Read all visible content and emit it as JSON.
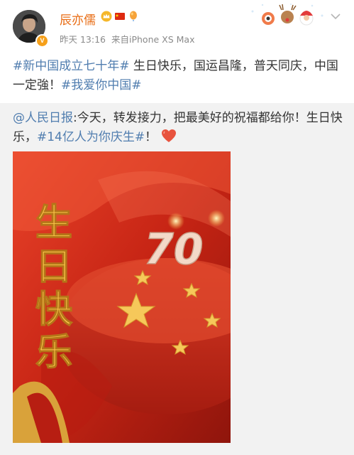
{
  "user": {
    "name": "辰亦儒",
    "verified_badge": "V",
    "time": "昨天 13:16",
    "source": "来自iPhone XS Max"
  },
  "post": {
    "tag1": "#新中国成立七十年#",
    "text1": " 生日快乐，国运昌隆，普天同庆，中国一定強！",
    "tag2": "#我爱你中国#"
  },
  "repost": {
    "mention": "@人民日报",
    "text1": ":今天，转发接力，把最美好的祝福都给你！生日快乐，",
    "tag": "#14亿人为你庆生#",
    "text2": "！"
  },
  "image": {
    "caption": "生日快乐",
    "number": "70"
  },
  "colors": {
    "name": "#e86b12",
    "link": "#507daf",
    "meta": "#8a8a8a",
    "repost_bg": "#f2f2f2",
    "heart": "#e8533e"
  },
  "icons": [
    "verified-badge-icon",
    "crown-badge-icon",
    "china-flag-icon",
    "balloon-icon",
    "chevron-down-icon",
    "heart-emoji-icon"
  ]
}
